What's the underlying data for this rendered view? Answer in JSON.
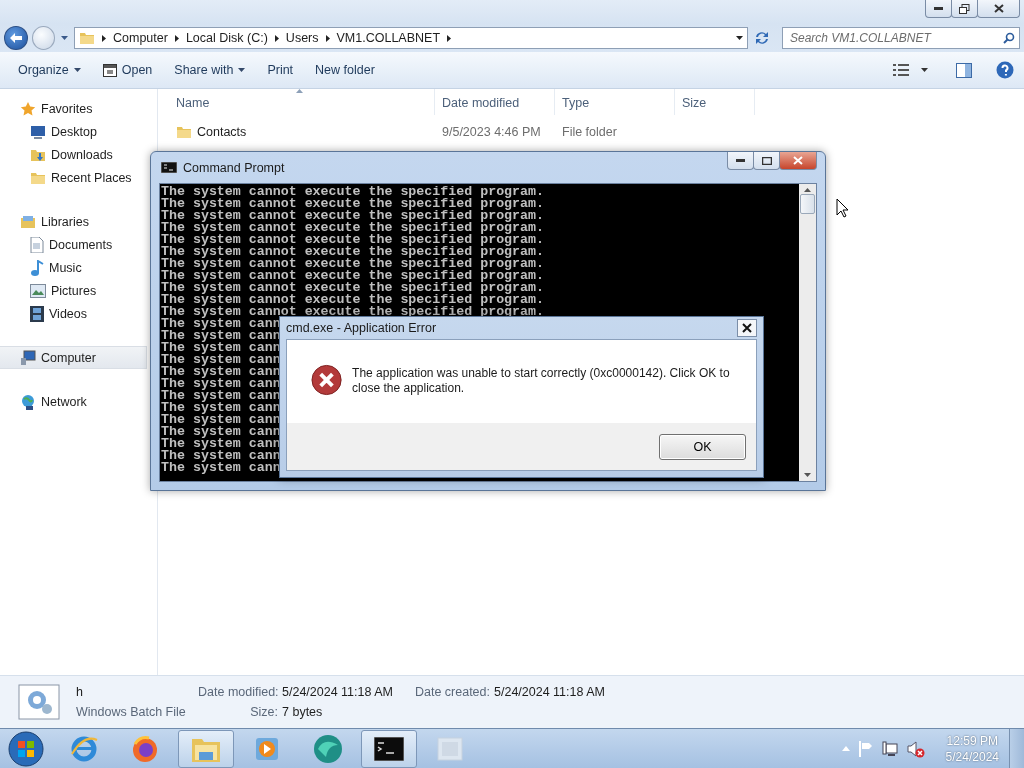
{
  "address": {
    "breadcrumb": [
      "Computer",
      "Local Disk (C:)",
      "Users",
      "VM1.COLLABNET"
    ]
  },
  "search": {
    "placeholder": "Search VM1.COLLABNET"
  },
  "toolbar": [
    {
      "label": "Organize",
      "kind": "menu"
    },
    {
      "label": "Open",
      "kind": "icon"
    },
    {
      "label": "Share with",
      "kind": "menu"
    },
    {
      "label": "Print",
      "kind": "plain"
    },
    {
      "label": "New folder",
      "kind": "plain"
    }
  ],
  "nav": [
    {
      "label": "Favorites",
      "selected": false,
      "children": [
        {
          "label": "Desktop",
          "selected": false
        },
        {
          "label": "Downloads",
          "selected": false
        },
        {
          "label": "Recent Places",
          "selected": false
        }
      ]
    },
    {
      "label": "Libraries",
      "selected": false,
      "children": [
        {
          "label": "Documents",
          "selected": false
        },
        {
          "label": "Music",
          "selected": false
        },
        {
          "label": "Pictures",
          "selected": false
        },
        {
          "label": "Videos",
          "selected": false
        }
      ]
    },
    {
      "label": "Computer",
      "selected": true
    },
    {
      "label": "Network",
      "selected": false
    }
  ],
  "table": {
    "columns": [
      "Name",
      "Date modified",
      "Type",
      "Size"
    ],
    "rows": [
      {
        "name": "Contacts",
        "date_modified": "9/5/2023 4:46 PM",
        "type": "File folder"
      }
    ]
  },
  "details": {
    "name": "h",
    "type": "Windows Batch File",
    "fields": [
      {
        "label": "Date modified:",
        "value": "5/24/2024 11:18 AM"
      },
      {
        "label": "Date created:",
        "value": "5/24/2024 11:18 AM"
      },
      {
        "label": "Size:",
        "value": "7 bytes"
      }
    ]
  },
  "cmd": {
    "title": "Command Prompt",
    "lines": [
      "The system cannot execute the specified program.",
      "The system cannot execute the specified program.",
      "The system cannot execute the specified program.",
      "The system cannot execute the specified program.",
      "The system cannot execute the specified program.",
      "The system cannot execute the specified program.",
      "The system cannot execute the specified program.",
      "The system cannot execute the specified program.",
      "The system cannot execute the specified program.",
      "The system cannot execute the specified program.",
      "The system cannot execute the specified program.",
      "The system cann",
      "The system cann",
      "The system cann",
      "The system cann",
      "The system cann",
      "The system cann",
      "The system cann",
      "The system cann",
      "The system cann",
      "The system cann",
      "The system cann",
      "The system cann",
      "The system cann"
    ]
  },
  "dialog": {
    "title": "cmd.exe - Application Error",
    "message": "The application was unable to start correctly (0xc0000142). Click OK to close the application.",
    "button": "OK"
  },
  "taskbar": {
    "apps": [
      {
        "active": false
      },
      {
        "active": false
      },
      {
        "active": true
      },
      {
        "active": false
      },
      {
        "active": false
      },
      {
        "active": true
      },
      {
        "active": false
      }
    ],
    "time": "12:59 PM",
    "date": "5/24/2024"
  }
}
